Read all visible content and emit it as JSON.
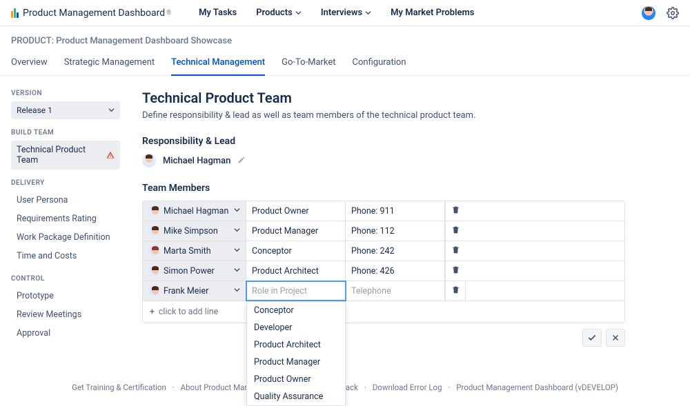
{
  "brand": {
    "name": "Product Management Dashboard",
    "reg": "®"
  },
  "topnav": {
    "my_tasks": "My Tasks",
    "products": "Products",
    "interviews": "Interviews",
    "market_problems": "My Market Problems"
  },
  "product_line": "PRODUCT: Product Management Dashboard Showcase",
  "tabs": {
    "overview": "Overview",
    "strategic": "Strategic Management",
    "technical": "Technical Management",
    "gtm": "Go-To-Market",
    "config": "Configuration"
  },
  "sidebar": {
    "version_label": "VERSION",
    "version_value": "Release 1",
    "build_label": "BUILD TEAM",
    "build_item": "Technical Product Team",
    "delivery_label": "DELIVERY",
    "delivery": {
      "user_persona": "User Persona",
      "req_rating": "Requirements Rating",
      "wpd": "Work Package Definition",
      "time_costs": "Time and Costs"
    },
    "control_label": "CONTROL",
    "control": {
      "prototype": "Prototype",
      "review": "Review Meetings",
      "approval": "Approval"
    }
  },
  "page": {
    "title": "Technical Product Team",
    "desc": "Define responsibility & lead as well as team members of the technical product team.",
    "resp_lead_heading": "Responsibility & Lead",
    "lead_name": "Michael Hagman",
    "team_heading": "Team Members"
  },
  "team": [
    {
      "name": "Michael Hagman",
      "role": "Product Owner",
      "phone": "Phone: 911"
    },
    {
      "name": "Mike Simpson",
      "role": "Product Manager",
      "phone": "Phone: 112"
    },
    {
      "name": "Marta Smith",
      "role": "Conceptor",
      "phone": "Phone: 242"
    },
    {
      "name": "Simon Power",
      "role": "Product Architect",
      "phone": "Phone: 426"
    },
    {
      "name": "Frank Meier",
      "role": "",
      "phone": ""
    }
  ],
  "placeholders": {
    "role": "Role in Project",
    "phone": "Telephone"
  },
  "dropdown_options": [
    "Conceptor",
    "Developer",
    "Product Architect",
    "Product Manager",
    "Product Owner",
    "Quality Assurance"
  ],
  "add_line": "click to add line",
  "footer": {
    "training": "Get Training & Certification",
    "about": "About Product Managemer",
    "feedback": "Provide Feedback",
    "errorlog": "Download Error Log",
    "dash": "Product Management Dashboard (vDEVELOP)"
  }
}
